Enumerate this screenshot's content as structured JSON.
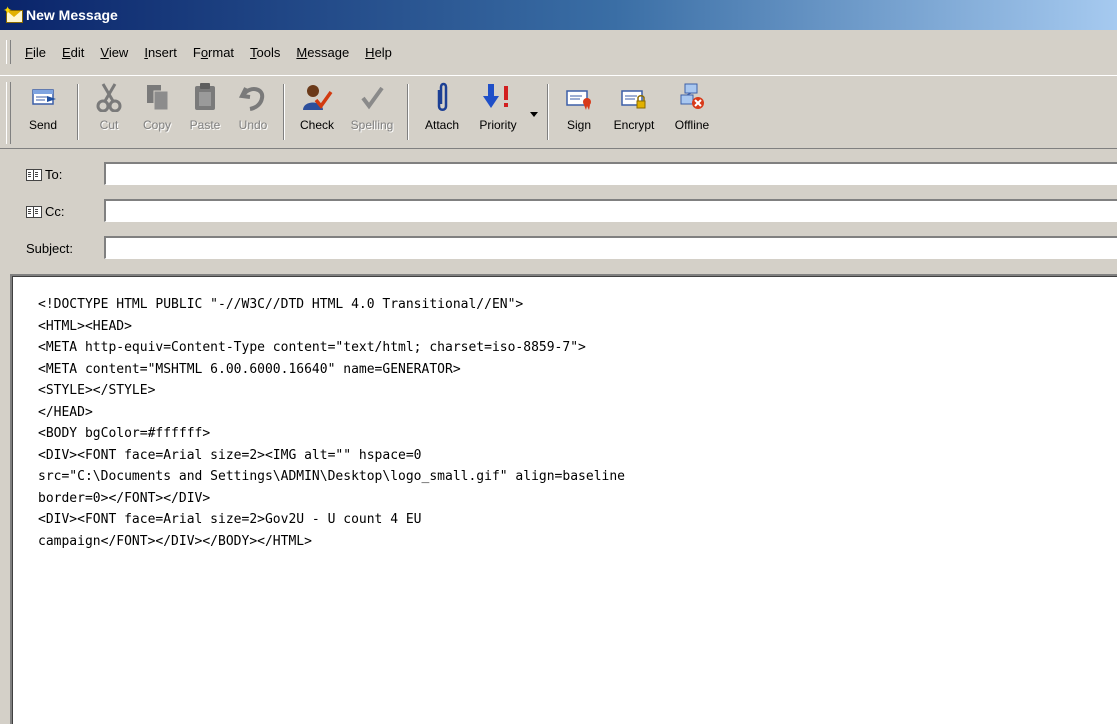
{
  "window": {
    "title": "New Message"
  },
  "menu": [
    {
      "pre": "",
      "mn": "F",
      "post": "ile"
    },
    {
      "pre": "",
      "mn": "E",
      "post": "dit"
    },
    {
      "pre": "",
      "mn": "V",
      "post": "iew"
    },
    {
      "pre": "",
      "mn": "I",
      "post": "nsert"
    },
    {
      "pre": "F",
      "mn": "o",
      "post": "rmat"
    },
    {
      "pre": "",
      "mn": "T",
      "post": "ools"
    },
    {
      "pre": "",
      "mn": "M",
      "post": "essage"
    },
    {
      "pre": "",
      "mn": "H",
      "post": "elp"
    }
  ],
  "toolbar": {
    "send": "Send",
    "cut": "Cut",
    "copy": "Copy",
    "paste": "Paste",
    "undo": "Undo",
    "check": "Check",
    "spelling": "Spelling",
    "attach": "Attach",
    "priority": "Priority",
    "sign": "Sign",
    "encrypt": "Encrypt",
    "offline": "Offline"
  },
  "fields": {
    "to_label": "To:",
    "to_value": "",
    "cc_label": "Cc:",
    "cc_value": "",
    "subject_label": "Subject:",
    "subject_value": ""
  },
  "body": {
    "text": "<!DOCTYPE HTML PUBLIC \"-//W3C//DTD HTML 4.0 Transitional//EN\">\n<HTML><HEAD>\n<META http-equiv=Content-Type content=\"text/html; charset=iso-8859-7\">\n<META content=\"MSHTML 6.00.6000.16640\" name=GENERATOR>\n<STYLE></STYLE>\n</HEAD>\n<BODY bgColor=#ffffff>\n<DIV><FONT face=Arial size=2><IMG alt=\"\" hspace=0\nsrc=\"C:\\Documents and Settings\\ADMIN\\Desktop\\logo_small.gif\" align=baseline\nborder=0></FONT></DIV>\n<DIV><FONT face=Arial size=2>Gov2U - U count 4 EU\ncampaign</FONT></DIV></BODY></HTML>"
  }
}
